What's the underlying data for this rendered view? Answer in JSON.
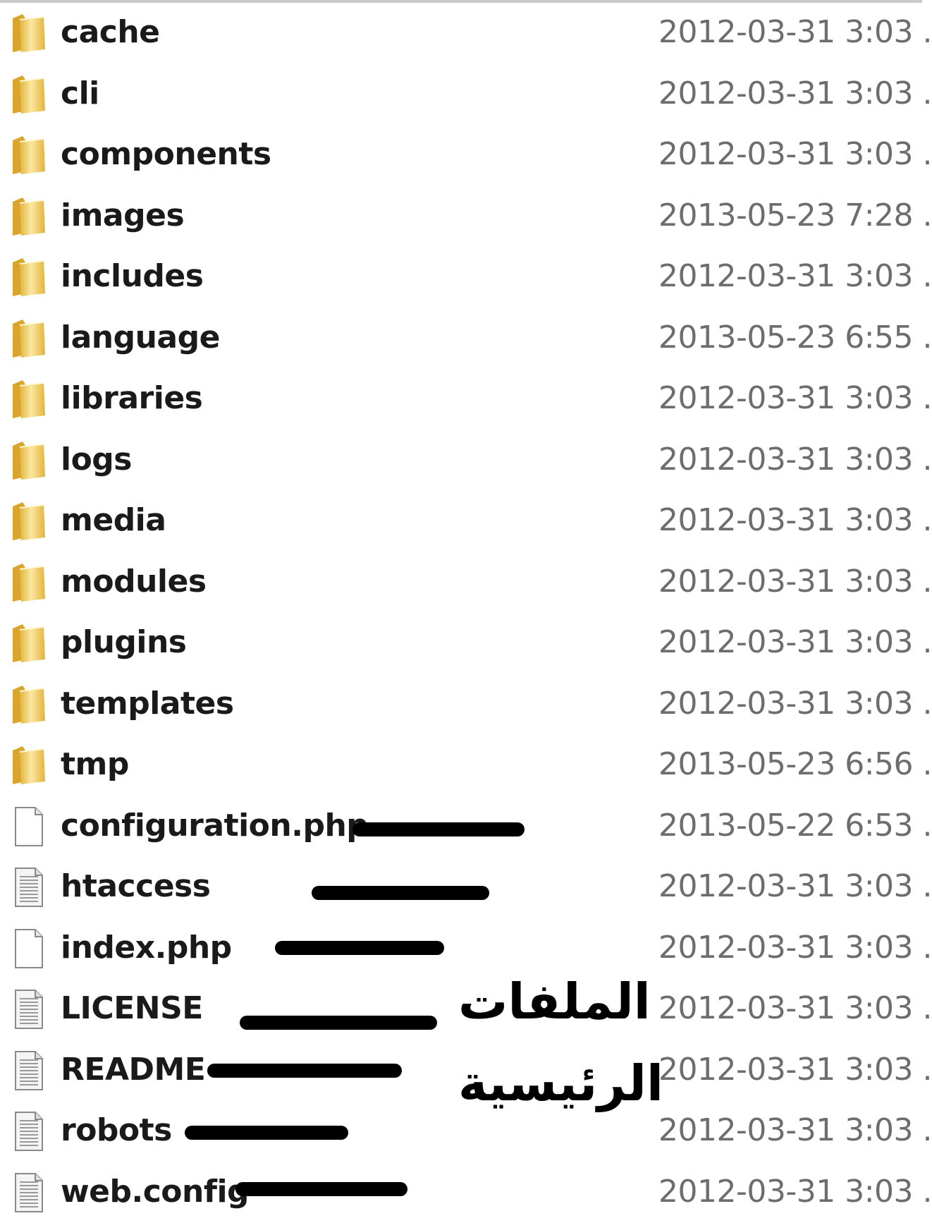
{
  "files": [
    {
      "name": "cache",
      "date": "2012-03-31 3:03 ...",
      "type": "folder"
    },
    {
      "name": "cli",
      "date": "2012-03-31 3:03 ...",
      "type": "folder"
    },
    {
      "name": "components",
      "date": "2012-03-31 3:03 ...",
      "type": "folder"
    },
    {
      "name": "images",
      "date": "2013-05-23 7:28 ...",
      "type": "folder"
    },
    {
      "name": "includes",
      "date": "2012-03-31 3:03 ...",
      "type": "folder"
    },
    {
      "name": "language",
      "date": "2013-05-23 6:55 ...",
      "type": "folder"
    },
    {
      "name": "libraries",
      "date": "2012-03-31 3:03 ...",
      "type": "folder"
    },
    {
      "name": "logs",
      "date": "2012-03-31 3:03 ...",
      "type": "folder"
    },
    {
      "name": "media",
      "date": "2012-03-31 3:03 ...",
      "type": "folder"
    },
    {
      "name": "modules",
      "date": "2012-03-31 3:03 ...",
      "type": "folder"
    },
    {
      "name": "plugins",
      "date": "2012-03-31 3:03 ...",
      "type": "folder"
    },
    {
      "name": "templates",
      "date": "2012-03-31 3:03 ...",
      "type": "folder"
    },
    {
      "name": "tmp",
      "date": "2013-05-23 6:56 ...",
      "type": "folder"
    },
    {
      "name": "configuration.php",
      "date": "2013-05-22 6:53 ...",
      "type": "file-blank"
    },
    {
      "name": "htaccess",
      "date": "2012-03-31 3:03 ...",
      "type": "file-text"
    },
    {
      "name": "index.php",
      "date": "2012-03-31 3:03 ...",
      "type": "file-blank"
    },
    {
      "name": "LICENSE",
      "date": "2012-03-31 3:03 ...",
      "type": "file-text"
    },
    {
      "name": "README",
      "date": "2012-03-31 3:03 ...",
      "type": "file-text"
    },
    {
      "name": "robots",
      "date": "2012-03-31 3:03 ...",
      "type": "file-text"
    },
    {
      "name": "web.config",
      "date": "2012-03-31 3:03 ...",
      "type": "file-text"
    }
  ],
  "annotation": {
    "line1": "الملفات",
    "line2": "الرئيسية"
  },
  "colors": {
    "folder_light": "#fbe7a1",
    "folder_dark": "#e2b43c",
    "name_text": "#1a1a1a",
    "date_text": "#6d6d6d",
    "marker": "#000000"
  }
}
